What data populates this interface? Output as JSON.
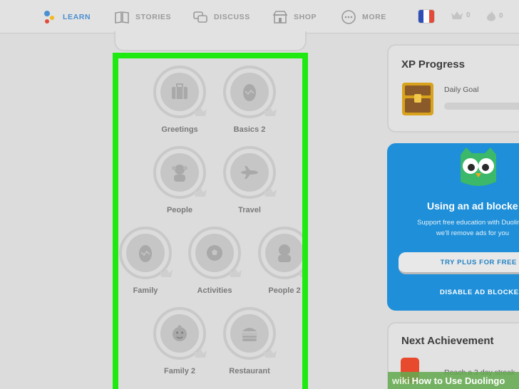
{
  "nav": {
    "learn": "LEARN",
    "stories": "STORIES",
    "discuss": "DISCUSS",
    "shop": "SHOP",
    "more": "MORE",
    "crowns": "0",
    "streak": "0",
    "flag": [
      "#2f4fb7",
      "#ffffff",
      "#e24a3a"
    ],
    "active_color": "#4a8fd0"
  },
  "top_fragment": "[cut-off text]",
  "highlight_color": "#1eea12",
  "skills": [
    {
      "label": "Greetings",
      "icon": "suitcase-icon"
    },
    {
      "label": "Basics 2",
      "icon": "egg-icon"
    },
    {
      "label": "People",
      "icon": "people-icon"
    },
    {
      "label": "Travel",
      "icon": "airplane-icon"
    },
    {
      "label": "Family",
      "icon": "egg-icon"
    },
    {
      "label": "Activities",
      "icon": "ball-icon"
    },
    {
      "label": "People 2",
      "icon": "people-icon"
    },
    {
      "label": "Family 2",
      "icon": "baby-icon"
    },
    {
      "label": "Restaurant",
      "icon": "burger-icon"
    }
  ],
  "xp": {
    "title": "XP Progress",
    "goal_label": "Daily Goal",
    "progress": 0
  },
  "ad": {
    "title": "Using an ad blocke",
    "line1": "Support free education with Duolingo",
    "line2": "we'll remove ads for you",
    "button": "TRY PLUS FOR FREE",
    "link": "DISABLE AD BLOCKER",
    "background": "#1e8fd8"
  },
  "achievement": {
    "title": "Next Achievement",
    "text": "Reach a 3 day streak"
  },
  "watermark": {
    "wiki": "wiki",
    "text": "How to Use Duolingo"
  }
}
